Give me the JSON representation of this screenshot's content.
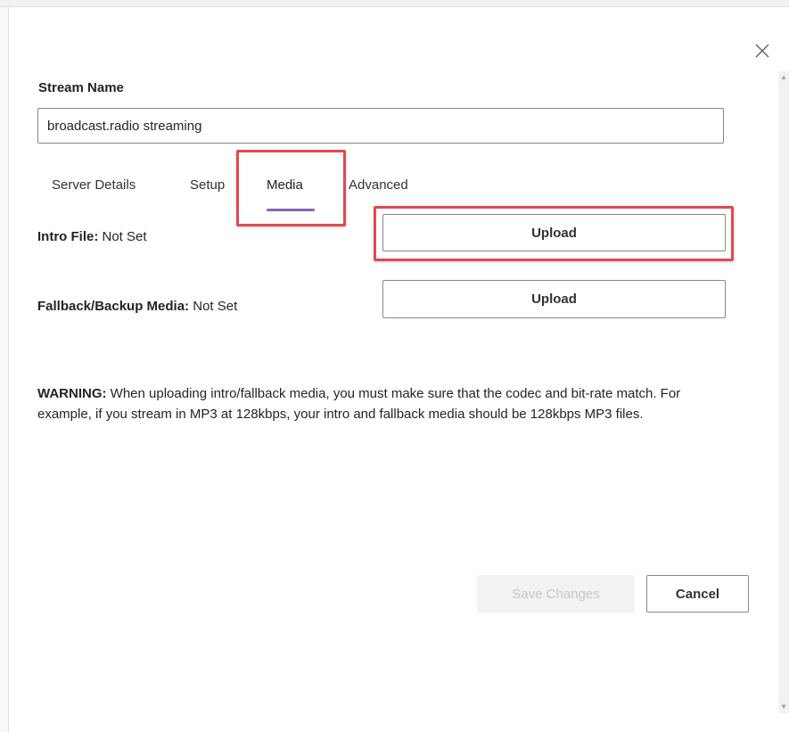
{
  "dialog": {
    "stream_name_label": "Stream Name",
    "stream_name_value": "broadcast.radio streaming"
  },
  "tabs": [
    {
      "label": "Server Details",
      "active": false
    },
    {
      "label": "Setup",
      "active": false
    },
    {
      "label": "Media",
      "active": true
    },
    {
      "label": "Advanced",
      "active": false
    }
  ],
  "media": {
    "intro_label": "Intro File:",
    "intro_status": "Not Set",
    "intro_button": "Upload",
    "fallback_label": "Fallback/Backup Media:",
    "fallback_status": "Not Set",
    "fallback_button": "Upload"
  },
  "warning": {
    "title": "WARNING:",
    "text": "When uploading intro/fallback media, you must make sure that the codec and bit-rate match. For example, if you stream in MP3 at 128kbps, your intro and fallback media should be 128kbps MP3 files."
  },
  "footer": {
    "save_label": "Save Changes",
    "cancel_label": "Cancel"
  },
  "colors": {
    "tab_accent": "#8764b8",
    "highlight_box": "#e04a50"
  },
  "icons": {
    "close": "close-icon"
  }
}
